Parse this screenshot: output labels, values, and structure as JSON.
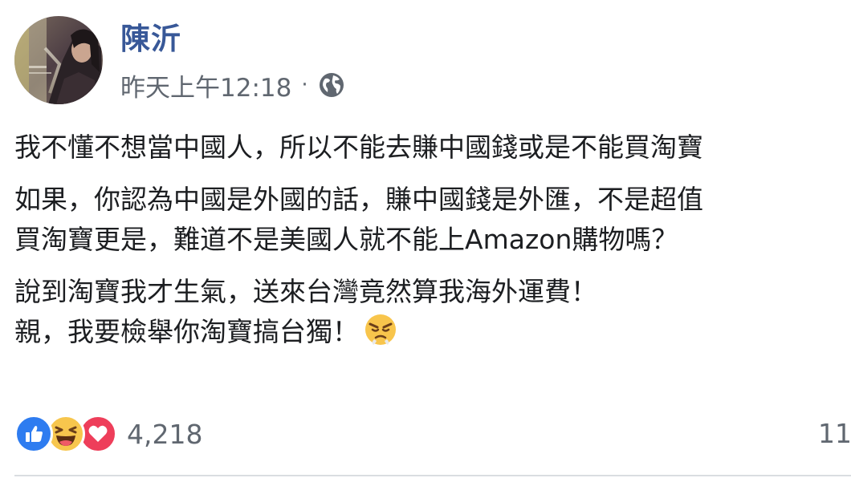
{
  "post": {
    "author": "陳沂",
    "timestamp": "昨天上午12:18",
    "separator": "·",
    "privacy_icon": "globe-icon",
    "body": {
      "p1": [
        "我不懂不想當中國人，所以不能去賺中國錢或是不能買淘寶"
      ],
      "p2": [
        "如果，你認為中國是外國的話，賺中國錢是外匯，不是超值",
        "買淘寶更是，難道不是美國人就不能上Amazon購物嗎？"
      ],
      "p3": [
        "說到淘寶我才生氣，送來台灣竟然算我海外運費！",
        "親，我要檢舉你淘寶搞台獨！"
      ],
      "p3_emoji": "pouting-face-emoji"
    }
  },
  "reactions": {
    "icons": [
      "like-icon",
      "haha-icon",
      "love-icon"
    ],
    "count": "4,218",
    "comments_partial": "11"
  },
  "colors": {
    "author_link": "#385898",
    "meta_text": "#606770",
    "like": "#2e7cf0",
    "haha": "#f7c64d",
    "love": "#ee3e5a",
    "divider": "#dadde1"
  }
}
